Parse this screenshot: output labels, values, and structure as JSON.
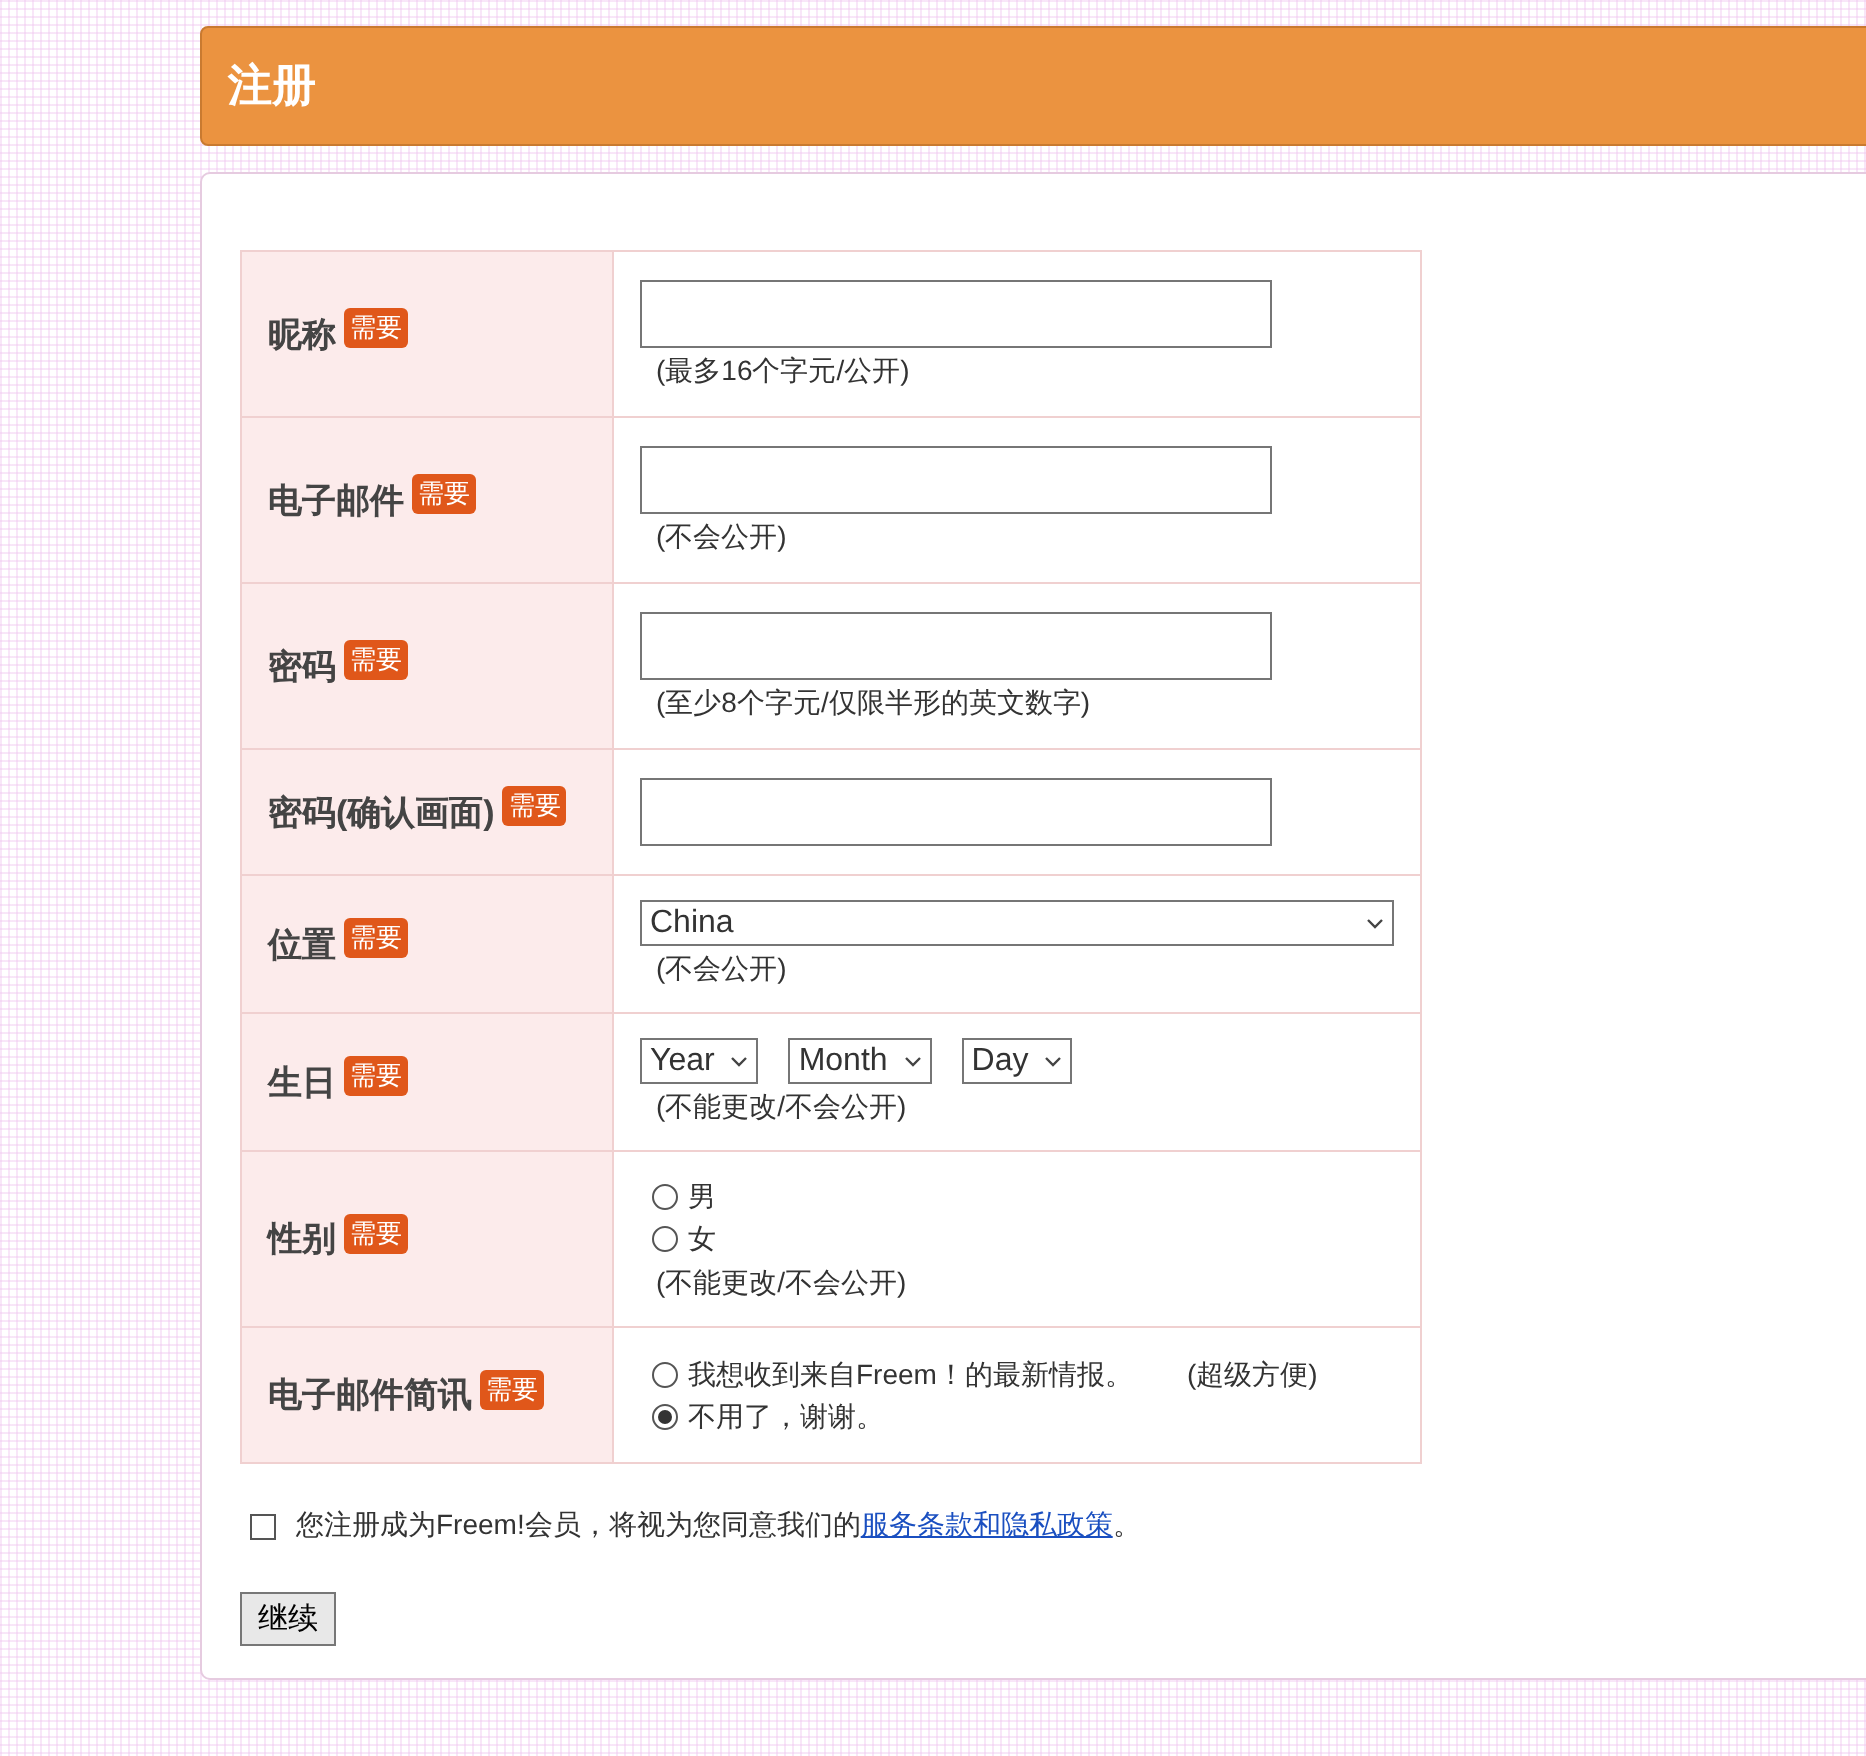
{
  "header": {
    "title": "注册"
  },
  "rows": [
    {
      "kind": "text",
      "label": "昵称",
      "badge": "需要",
      "hint": "(最多16个字元/公开)"
    },
    {
      "kind": "text",
      "label": "电子邮件",
      "badge": "需要",
      "hint": "(不会公开)"
    },
    {
      "kind": "text",
      "label": "密码",
      "badge": "需要",
      "hint": "(至少8个字元/仅限半形的英文数字)"
    },
    {
      "kind": "text",
      "label": "密码(确认画面)",
      "badge": "需要"
    },
    {
      "kind": "select",
      "label": "位置",
      "badge": "需要",
      "value": "China",
      "hint": "(不会公开)"
    },
    {
      "kind": "date",
      "label": "生日",
      "badge": "需要",
      "selects": [
        "Year",
        "Month",
        "Day"
      ],
      "hint": "(不能更改/不会公开)"
    },
    {
      "kind": "radio",
      "label": "性别",
      "badge": "需要",
      "options": [
        {
          "label": "男",
          "selected": false
        },
        {
          "label": "女",
          "selected": false
        }
      ],
      "hint": "(不能更改/不会公开)"
    },
    {
      "kind": "radio",
      "label": "电子邮件简讯",
      "badge": "需要",
      "options": [
        {
          "label": "我想收到来自Freem！的最新情报。",
          "note": "(超级方便)",
          "selected": false
        },
        {
          "label": "不用了，谢谢。",
          "selected": true
        }
      ]
    }
  ],
  "agreement": {
    "checked": false,
    "text": "您注册成为Freem!会员，将视为您同意我们的",
    "link": "服务条款和隐私政策",
    "suffix": "。"
  },
  "submit": "继续"
}
